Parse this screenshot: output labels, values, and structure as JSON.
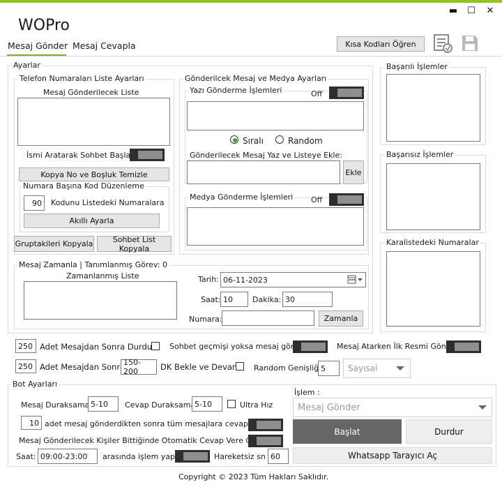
{
  "app": {
    "title": "WOPro"
  },
  "window": {
    "minimize": "▬",
    "maximize": "☐",
    "close": "✕"
  },
  "tabs": [
    {
      "label": "Mesaj Gönder"
    },
    {
      "label": "Mesaj Cevapla"
    }
  ],
  "header": {
    "shortcuts_button": "Kısa Kodları Öğren"
  },
  "settings": {
    "group_title": "Ayarlar",
    "phone_list": {
      "title": "Telefon Numaraları Liste Ayarları",
      "list_label": "Mesaj Gönderilecek Liste",
      "search_chat_label": "İsmi Aratarak Sohbet Başlat",
      "copy_clean_button": "Kopya No ve Boşluk Temizle",
      "code_group_title": "Numara Başına Kod Düzenleme",
      "code_value": "90",
      "code_label": "Kodunu Listedeki Numaralara",
      "smart_button": "Akıllı Ayarla",
      "copy_groups_button": "Gruptakileri Kopyala",
      "copy_chats_button": "Sohbet List Kopyala"
    },
    "message_media": {
      "title": "Gönderilcek Mesaj ve Medya Ayarları",
      "text_send_title": "Yazı Gönderme İşlemleri",
      "text_send_state": "Off",
      "radio_sequential": "Sıralı",
      "radio_random": "Random",
      "write_add_label": "Gönderilecek Mesaj Yaz ve Listeye Ekle:",
      "add_button": "Ekle",
      "media_send_title": "Medya Gönderme İşlemleri",
      "media_send_state": "Off"
    },
    "schedule": {
      "title": "Mesaj Zamanla | Tanımlanmış Görev: 0",
      "list_label": "Zamanlanmış Liste",
      "date_label": "Tarih:",
      "date_value": "06-11-2023",
      "hour_label": "Saat:",
      "hour_value": "10",
      "minute_label": "Dakika:",
      "minute_value": "30",
      "number_label": "Numara:",
      "number_value": "",
      "schedule_button": "Zamanla"
    }
  },
  "side_lists": {
    "success": "Başarılı İşlemler",
    "failed": "Başarısız İşlemler",
    "blacklist": "Karalistedeki Numaralar"
  },
  "options": {
    "stop_after_value": "250",
    "stop_after_label": "Adet Mesajdan Sonra Durdur",
    "no_history_label": "Sohbet geçmişi yoksa mesaj gönder",
    "official_label": "Mesaj Atarken İlk Resmi Gönder:",
    "wait_after_value": "250",
    "wait_after_label": "Adet Mesajdan Sonra",
    "wait_range_value": "150-200",
    "wait_range_label": "DK Bekle ve Devam",
    "random_width_label": "Random Genişliği:",
    "random_width_value": "5",
    "random_type_value": "Sayısal"
  },
  "bot": {
    "group_title": "Bot Ayarları",
    "msg_pause_label": "Mesaj Duraksama:",
    "msg_pause_value": "5-10",
    "reply_pause_label": "Cevap Duraksama:",
    "reply_pause_value": "5-10",
    "ultra_label": "Ultra Hız",
    "reply_all_value": "10",
    "reply_all_label": "adet mesaj gönderdikten sonra tüm mesajlara cevap ver",
    "auto_reply_label": "Mesaj Gönderilecek Kişiler Bittiğinde Otomatik Cevap Vere Geç",
    "time_label": "Saat:",
    "time_value": "09:00-23:00",
    "time_suffix": "arasında işlem yap",
    "idle_label": "Hareketsiz sn :",
    "idle_value": "60",
    "operation_label": "İşlem :",
    "operation_value": "Mesaj Gönder",
    "start_button": "Başlat",
    "stop_button": "Durdur",
    "browser_button": "Whatsapp Tarayıcı Aç"
  },
  "footer": {
    "copyright": "Copyright © 2023 Tüm Hakları Saklıdır."
  }
}
